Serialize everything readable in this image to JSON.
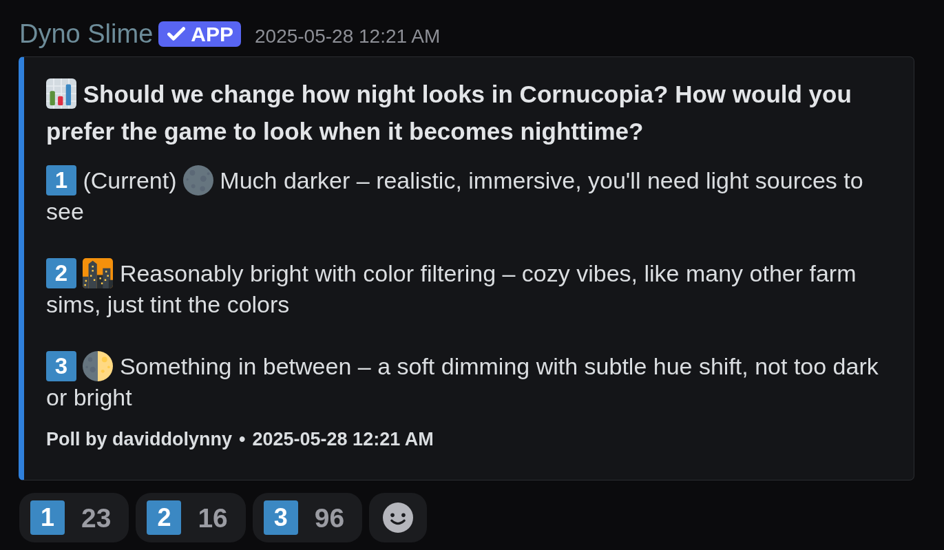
{
  "message": {
    "author": "Dyno Slime",
    "badge": {
      "label": "APP",
      "verified": true
    },
    "timestamp": "2025-05-28 12:21 AM"
  },
  "poll_embed": {
    "question": "Should we change how night looks in Cornucopia? How would you prefer the game to look when it becomes nighttime?",
    "options": [
      {
        "keycap": "1",
        "note": "(Current)",
        "kind": "moon",
        "text": "Much darker – realistic, immersive, you'll need light sources to see"
      },
      {
        "keycap": "2",
        "kind": "city",
        "text": "Reasonably bright with color filtering – cozy vibes, like many other farm sims, just tint the colors"
      },
      {
        "keycap": "3",
        "kind": "halfmoon",
        "text": "Something in between – a soft dimming with subtle hue shift, not too dark or bright"
      }
    ],
    "footer": {
      "author": "Poll by daviddolynny",
      "separator": "•",
      "timestamp": "2025-05-28 12:21 AM"
    }
  },
  "reactions": [
    {
      "keycap": "1",
      "count": "23"
    },
    {
      "keycap": "2",
      "count": "16"
    },
    {
      "keycap": "3",
      "count": "96"
    }
  ]
}
